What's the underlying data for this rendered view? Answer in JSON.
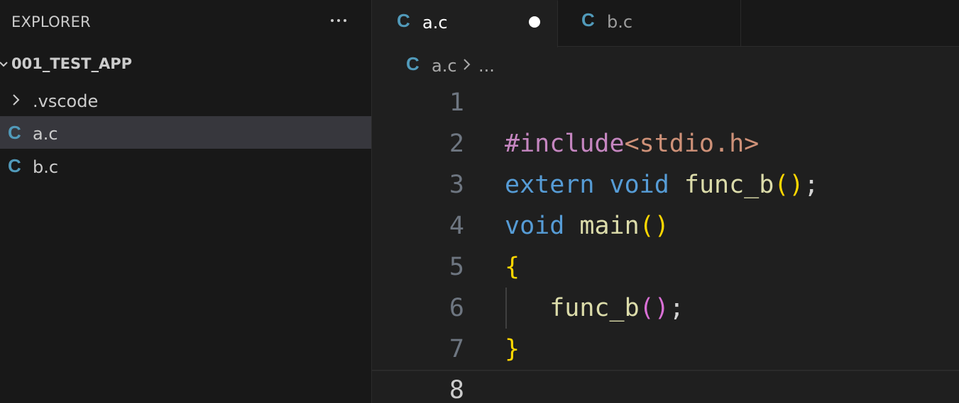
{
  "sidebar": {
    "title": "EXPLORER",
    "more_actions_icon": "ellipsis-icon",
    "folder": {
      "name": "001_TEST_APP",
      "expanded": true
    },
    "items": [
      {
        "label": ".vscode",
        "type": "folder",
        "selected": false
      },
      {
        "label": "a.c",
        "type": "c-file",
        "icon_glyph": "C",
        "selected": true
      },
      {
        "label": "b.c",
        "type": "c-file",
        "icon_glyph": "C",
        "selected": false
      }
    ]
  },
  "editor": {
    "tabs": [
      {
        "label": "a.c",
        "icon_glyph": "C",
        "active": true,
        "dirty": true
      },
      {
        "label": "b.c",
        "icon_glyph": "C",
        "active": false,
        "dirty": false
      }
    ],
    "breadcrumb": {
      "icon_glyph": "C",
      "file": "a.c",
      "more": "..."
    },
    "current_line": 8,
    "lines": [
      {
        "number": "1",
        "tokens": []
      },
      {
        "number": "2",
        "tokens": [
          {
            "text": "#include",
            "kind": "pp"
          },
          {
            "text": "<stdio.h>",
            "kind": "inc"
          }
        ]
      },
      {
        "number": "3",
        "tokens": [
          {
            "text": "extern",
            "kind": "kw"
          },
          {
            "text": " ",
            "kind": "punct"
          },
          {
            "text": "void",
            "kind": "kw"
          },
          {
            "text": " ",
            "kind": "punct"
          },
          {
            "text": "func_b",
            "kind": "fn"
          },
          {
            "text": "()",
            "kind": "br1"
          },
          {
            "text": ";",
            "kind": "punct"
          }
        ]
      },
      {
        "number": "4",
        "tokens": [
          {
            "text": "void",
            "kind": "kw"
          },
          {
            "text": " ",
            "kind": "punct"
          },
          {
            "text": "main",
            "kind": "fn"
          },
          {
            "text": "()",
            "kind": "br1"
          }
        ]
      },
      {
        "number": "5",
        "tokens": [
          {
            "text": "{",
            "kind": "br1"
          }
        ]
      },
      {
        "number": "6",
        "indent": true,
        "tokens": [
          {
            "text": "   ",
            "kind": "punct"
          },
          {
            "text": "func_b",
            "kind": "fn"
          },
          {
            "text": "()",
            "kind": "br2"
          },
          {
            "text": ";",
            "kind": "punct"
          }
        ]
      },
      {
        "number": "7",
        "tokens": [
          {
            "text": "}",
            "kind": "br1"
          }
        ]
      },
      {
        "number": "8",
        "tokens": []
      }
    ]
  },
  "colors": {
    "c_icon": "#519aba",
    "keyword": "#569cd6",
    "function": "#dcdcaa",
    "preprocessor": "#c586c0",
    "include_path": "#ce9178",
    "bracket_level1": "#ffd700",
    "bracket_level2": "#da70d6",
    "selection": "#37373d"
  }
}
